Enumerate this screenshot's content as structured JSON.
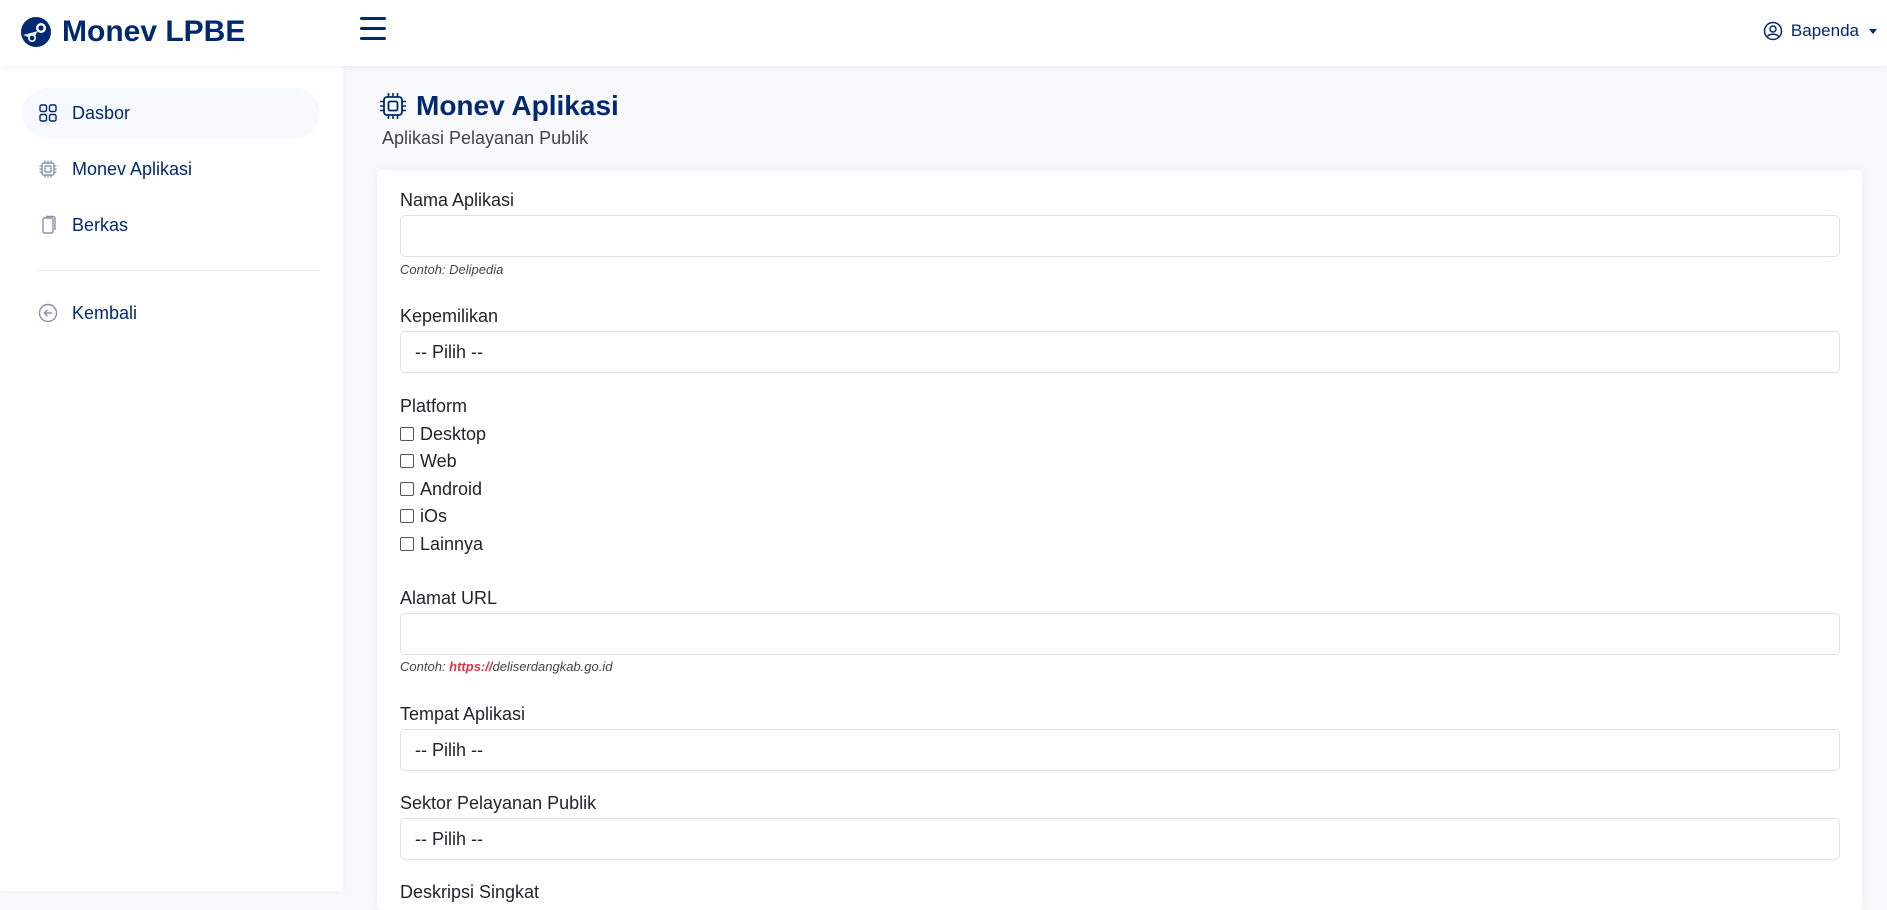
{
  "brand": {
    "title": "Monev LPBE"
  },
  "user": {
    "name": "Bapenda"
  },
  "sidebar": {
    "items": [
      {
        "label": "Dasbor"
      },
      {
        "label": "Monev Aplikasi"
      },
      {
        "label": "Berkas"
      },
      {
        "label": "Kembali"
      }
    ]
  },
  "page": {
    "title": "Monev Aplikasi",
    "subtitle": "Aplikasi Pelayanan Publik"
  },
  "form": {
    "nama_label": "Nama Aplikasi",
    "nama_value": "",
    "nama_hint": "Contoh: Delipedia",
    "kepemilikan_label": "Kepemilikan",
    "kepemilikan_value": "-- Pilih --",
    "platform_label": "Platform",
    "platforms": [
      "Desktop",
      "Web",
      "Android",
      "iOs",
      "Lainnya"
    ],
    "url_label": "Alamat URL",
    "url_value": "",
    "url_hint_prefix": "Contoh: ",
    "url_hint_scheme": "https://",
    "url_hint_domain": "deliserdangkab.go.id",
    "tempat_label": "Tempat Aplikasi",
    "tempat_value": "-- Pilih --",
    "sektor_label": "Sektor Pelayanan Publik",
    "sektor_value": "-- Pilih --",
    "next_label": "Deskripsi Singkat"
  },
  "colors": {
    "primary": "#012970",
    "hint_red": "#dc3545",
    "active_bg": "#f6f9ff"
  }
}
